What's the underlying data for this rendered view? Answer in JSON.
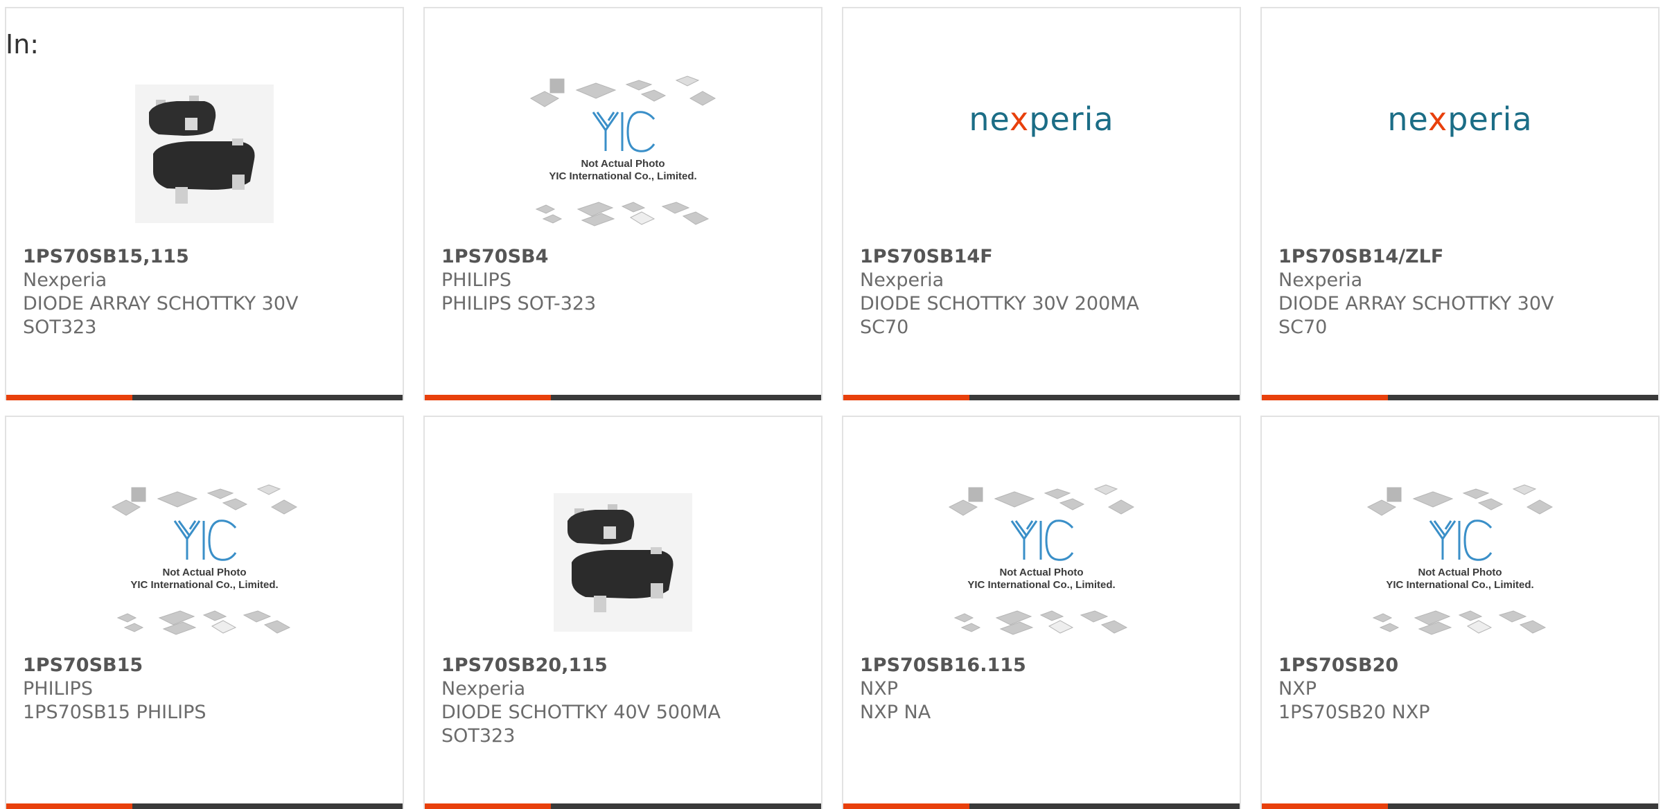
{
  "header": {
    "in_label": "In:"
  },
  "colors": {
    "accent": "#e8400c",
    "bar": "#3a3a3a",
    "brand": "#1b6d86"
  },
  "logo_text": {
    "nex_a": "ne",
    "nex_x": "x",
    "nex_b": "peria"
  },
  "placeholder": {
    "line1": "Not Actual Photo",
    "line2": "YIC International Co., Limited."
  },
  "products": [
    {
      "part_number": "1PS70SB15,115",
      "manufacturer": "Nexperia",
      "description": "DIODE ARRAY SCHOTTKY 30V\nSOT323",
      "image": "diode-photo"
    },
    {
      "part_number": "1PS70SB4",
      "manufacturer": "PHILIPS",
      "description": "PHILIPS SOT-323",
      "image": "yic-placeholder"
    },
    {
      "part_number": "1PS70SB14F",
      "manufacturer": "Nexperia",
      "description": "DIODE SCHOTTKY 30V 200MA\nSC70",
      "image": "nexperia-logo"
    },
    {
      "part_number": "1PS70SB14/ZLF",
      "manufacturer": "Nexperia",
      "description": "DIODE ARRAY SCHOTTKY 30V\nSC70",
      "image": "nexperia-logo"
    },
    {
      "part_number": "1PS70SB15",
      "manufacturer": "PHILIPS",
      "description": "1PS70SB15 PHILIPS",
      "image": "yic-placeholder"
    },
    {
      "part_number": "1PS70SB20,115",
      "manufacturer": "Nexperia",
      "description": "DIODE SCHOTTKY 40V 500MA\nSOT323",
      "image": "diode-photo"
    },
    {
      "part_number": "1PS70SB16.115",
      "manufacturer": "NXP",
      "description": "NXP NA",
      "image": "yic-placeholder"
    },
    {
      "part_number": "1PS70SB20",
      "manufacturer": "NXP",
      "description": "1PS70SB20 NXP",
      "image": "yic-placeholder"
    }
  ]
}
